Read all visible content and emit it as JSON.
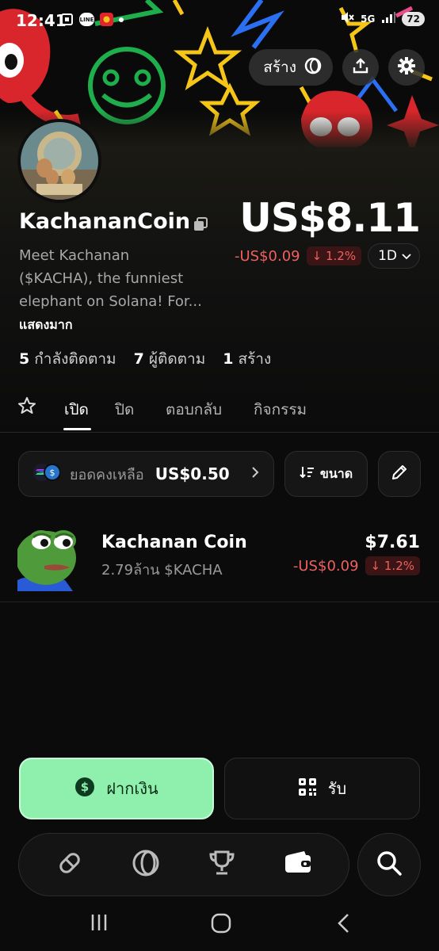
{
  "status_bar": {
    "time": "12:41",
    "left_badge_text": "LINE",
    "network": "5G",
    "battery": "72"
  },
  "header": {
    "create_label": "สร้าง",
    "icons": [
      "ring-logo-icon",
      "share-icon",
      "settings-gear-icon"
    ]
  },
  "profile": {
    "name": "KachananCoin",
    "price": "US$8.11",
    "change_value": "-US$0.09",
    "change_percent": "1.2%",
    "period": "1D",
    "description_lines": [
      "Meet Kachanan",
      "($KACHA), the funniest",
      "elephant on Solana! For..."
    ],
    "show_more": "แสดงมาก",
    "stats": [
      {
        "count": "5",
        "label": "กำลังติดตาม"
      },
      {
        "count": "7",
        "label": "ผู้ติดตาม"
      },
      {
        "count": "1",
        "label": "สร้าง"
      }
    ]
  },
  "tabs": [
    {
      "label": "เปิด",
      "active": true
    },
    {
      "label": "ปิด",
      "active": false
    },
    {
      "label": "ตอบกลับ",
      "active": false
    },
    {
      "label": "กิจกรรม",
      "active": false
    }
  ],
  "toolbar": {
    "balance_label": "ยอดคงเหลือ",
    "balance_value": "US$0.50",
    "sort_label": "ขนาด"
  },
  "tokens": [
    {
      "name": "Kachanan Coin",
      "amount": "2.79ล้าน $KACHA",
      "value": "$7.61",
      "change_value": "-US$0.09",
      "change_percent": "1.2%"
    }
  ],
  "actions": {
    "deposit_label": "ฝากเงิน",
    "receive_label": "รับ"
  },
  "colors": {
    "accent_green": "#8ff0ae",
    "negative_red": "#f0605e",
    "background": "#0b0b0b"
  }
}
